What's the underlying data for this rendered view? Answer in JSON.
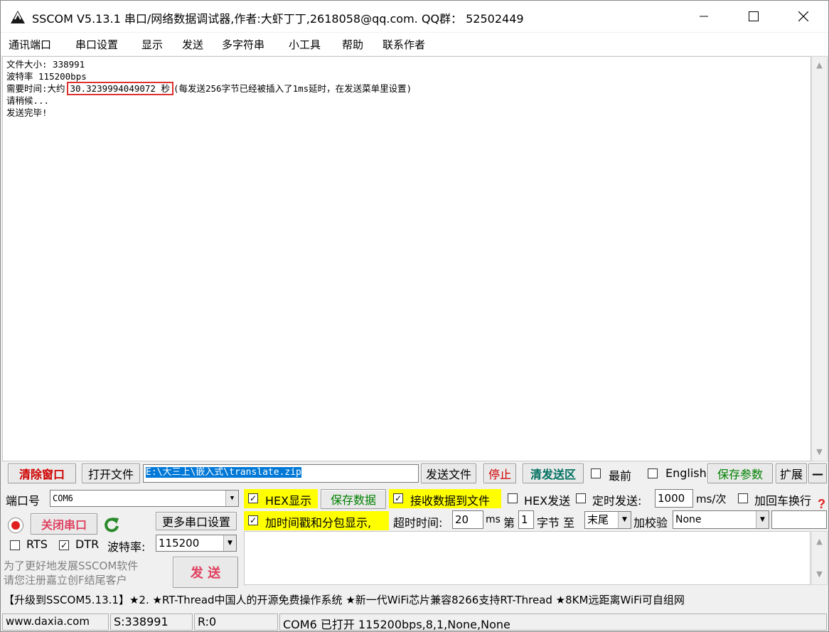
{
  "window": {
    "title": "SSCOM V5.13.1 串口/网络数据调试器,作者:大虾丁丁,2618058@qq.com. QQ群： 52502449"
  },
  "menu": [
    "通讯端口",
    "串口设置",
    "显示",
    "发送",
    "多字符串",
    "小工具",
    "帮助",
    "联系作者"
  ],
  "receive": {
    "line1": "文件大小: 338991",
    "line2": "波特率 115200bps",
    "line3_prefix": "需要时间:大约",
    "line3_highlight": "30.3239994049072 秒",
    "line3_suffix": "(每发送256字节已经被插入了1ms延时，在发送菜单里设置)",
    "line4": "请稍候...",
    "line5": "发送完毕!"
  },
  "toolbar": {
    "clear_window": "清除窗口",
    "open_file": "打开文件",
    "file_path": "E:\\大三上\\嵌入式\\translate.zip",
    "send_file": "发送文件",
    "stop": "停止",
    "clear_send": "清发送区",
    "topmost": "最前",
    "english": "English",
    "save_params": "保存参数",
    "expand": "扩展",
    "collapse": "—"
  },
  "port": {
    "port_label": "端口号",
    "port_value": "COM6",
    "close_port": "关闭串口",
    "more_settings": "更多串口设置",
    "rts": "RTS",
    "dtr": "DTR",
    "baud_label": "波特率:",
    "baud_value": "115200",
    "promo1": "为了更好地发展SSCOM软件",
    "promo2": "请您注册嘉立创F结尾客户",
    "send": "发 送"
  },
  "options": {
    "hex_display": "HEX显示",
    "save_data": "保存数据",
    "recv_to_file": "接收数据到文件",
    "hex_send": "HEX发送",
    "timed_send": "定时发送:",
    "interval": "1000",
    "interval_unit": "ms/次",
    "add_crlf": "加回车换行",
    "timestamp": "加时间戳和分包显示,",
    "timeout_label": "超时时间:",
    "timeout_value": "20",
    "ms": "ms",
    "byte_no_label": "第",
    "byte_no": "1",
    "byte_unit": "字节 至",
    "to_value": "末尾",
    "checksum_label": "加校验",
    "checksum_value": "None"
  },
  "ticker": "【升级到SSCOM5.13.1】★2. ★RT-Thread中国人的开源免费操作系统 ★新一代WiFi芯片兼容8266支持RT-Thread ★8KM远距离WiFi可自组网",
  "status": {
    "site": "www.daxia.com",
    "sent": "S:338991",
    "recv": "R:0",
    "port_state": "COM6 已打开  115200bps,8,1,None,None"
  }
}
